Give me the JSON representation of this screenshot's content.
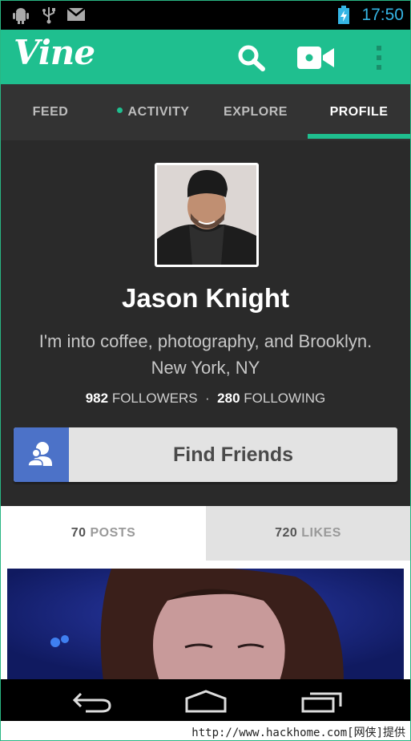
{
  "status_bar": {
    "time": "17:50",
    "icons": [
      "android-debug-icon",
      "usb-icon",
      "gmail-icon",
      "battery-charging-icon"
    ]
  },
  "action_bar": {
    "logo": "Vine",
    "icons": [
      "search-icon",
      "video-camera-icon",
      "overflow-menu-icon"
    ],
    "accent_color": "#1fbf8f"
  },
  "tabs": [
    {
      "label": "FEED",
      "active": false,
      "dot": false
    },
    {
      "label": "ACTIVITY",
      "active": false,
      "dot": true
    },
    {
      "label": "EXPLORE",
      "active": false,
      "dot": false
    },
    {
      "label": "PROFILE",
      "active": true,
      "dot": false
    }
  ],
  "profile": {
    "name": "Jason Knight",
    "bio": "I'm into coffee, photography, and Brooklyn.",
    "location": "New York, NY",
    "followers_count": "982",
    "followers_label": "FOLLOWERS",
    "separator": "·",
    "following_count": "280",
    "following_label": "FOLLOWING",
    "find_friends_label": "Find Friends",
    "find_friends_icon": "add-friends-icon",
    "find_friends_color": "#4c72c8"
  },
  "content_tabs": {
    "posts_count": "70",
    "posts_label": "POSTS",
    "likes_count": "720",
    "likes_label": "LIKES"
  },
  "nav_bar": {
    "icons": [
      "back-icon",
      "home-icon",
      "recent-apps-icon"
    ]
  },
  "watermark": "http://www.hackhome.com[网侠]提供"
}
